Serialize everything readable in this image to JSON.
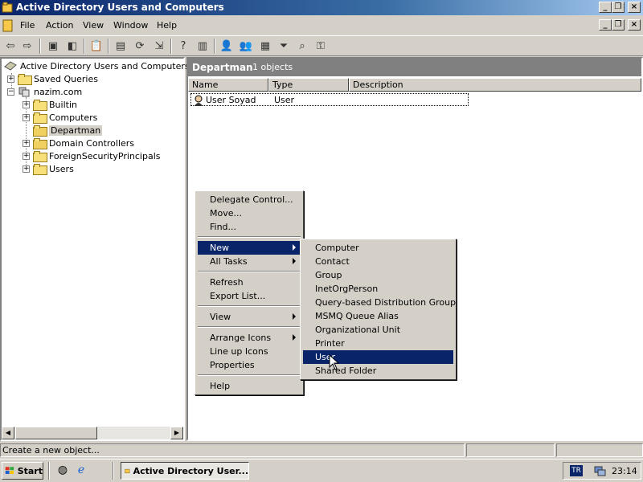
{
  "window": {
    "title": "Active Directory Users and Computers",
    "caption_buttons": [
      "minimize",
      "maximize",
      "close"
    ]
  },
  "menubar": {
    "items": [
      {
        "label": "File"
      },
      {
        "label": "Action"
      },
      {
        "label": "View"
      },
      {
        "label": "Window"
      },
      {
        "label": "Help"
      }
    ]
  },
  "toolbar": {
    "icons": [
      "back-icon",
      "forward-icon",
      "up-folder-icon",
      "show-tree-icon",
      "paste-icon",
      "properties-icon",
      "refresh-icon",
      "export-icon",
      "help-icon",
      "console-icon",
      "new-user-icon",
      "new-group-icon",
      "new-ou-icon",
      "filter-icon",
      "find-icon",
      "delegate-icon"
    ]
  },
  "tree": {
    "root": "Active Directory Users and Computers [srv",
    "items": [
      {
        "label": "Saved Queries",
        "level": 1
      },
      {
        "label": "nazim.com",
        "level": 1
      },
      {
        "label": "Builtin",
        "level": 2
      },
      {
        "label": "Computers",
        "level": 2
      },
      {
        "label": "Departman",
        "level": 2,
        "selected": true
      },
      {
        "label": "Domain Controllers",
        "level": 2
      },
      {
        "label": "ForeignSecurityPrincipals",
        "level": 2
      },
      {
        "label": "Users",
        "level": 2
      }
    ]
  },
  "details": {
    "header_title": "Departman",
    "header_count": "1 objects",
    "columns": [
      "Name",
      "Type",
      "Description"
    ],
    "rows": [
      {
        "name": "User Soyad",
        "type": "User",
        "description": ""
      }
    ]
  },
  "context_menu": {
    "items": [
      {
        "label": "Delegate Control..."
      },
      {
        "label": "Move..."
      },
      {
        "label": "Find..."
      },
      {
        "label": "New",
        "submenu": true,
        "selected": true
      },
      {
        "label": "All Tasks",
        "submenu": true
      },
      {
        "label": "Refresh"
      },
      {
        "label": "Export List..."
      },
      {
        "label": "View",
        "submenu": true
      },
      {
        "label": "Arrange Icons",
        "submenu": true
      },
      {
        "label": "Line up Icons"
      },
      {
        "label": "Properties"
      },
      {
        "label": "Help"
      }
    ]
  },
  "submenu_new": {
    "items": [
      {
        "label": "Computer"
      },
      {
        "label": "Contact"
      },
      {
        "label": "Group"
      },
      {
        "label": "InetOrgPerson"
      },
      {
        "label": "Query-based Distribution Group"
      },
      {
        "label": "MSMQ Queue Alias"
      },
      {
        "label": "Organizational Unit"
      },
      {
        "label": "Printer"
      },
      {
        "label": "User",
        "selected": true
      },
      {
        "label": "Shared Folder"
      }
    ]
  },
  "statusbar": {
    "text": "Create a new object..."
  },
  "taskbar": {
    "start_label": "Start",
    "task_label": "Active Directory User...",
    "language": "TR",
    "clock": "23:14"
  },
  "colors": {
    "title_gradient_start": "#0a246a",
    "selection": "#0a246a",
    "face": "#d4d0c8"
  }
}
